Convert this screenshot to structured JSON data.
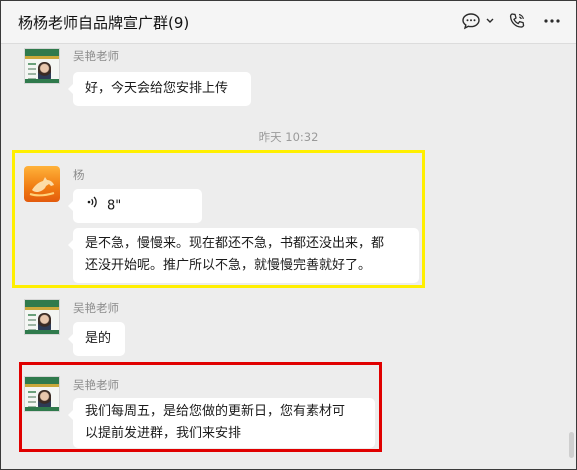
{
  "header": {
    "title": "杨杨老师自品牌宣广群",
    "member_count": "(9)",
    "icons": [
      "chat-bubble-icon",
      "chevron-down-icon",
      "voice-call-icon",
      "more-icon"
    ]
  },
  "messages": [
    {
      "sender": "吴艳老师",
      "text": "好，今天会给您安排上传",
      "avatar": "business-card-avatar"
    },
    {
      "timestamp": "昨天 10:32"
    },
    {
      "sender": "杨",
      "voice_duration": "8\"",
      "avatar": "horse-avatar",
      "text": "是不急，慢慢来。现在都还不急，书都还没出来，都还没开始呢。推广所以不急，就慢慢完善就好了。",
      "text_lines": [
        "是不急，慢慢来。现在都还不急，书都还没出来，都",
        "还没开始呢。推广所以不急，就慢慢完善就好了。"
      ]
    },
    {
      "sender": "吴艳老师",
      "text": "是的",
      "avatar": "business-card-avatar"
    },
    {
      "sender": "吴艳老师",
      "avatar": "business-card-avatar",
      "text": "我们每周五，是给您做的更新日，您有素材可以提前发进群，我们来安排",
      "text_lines": [
        "我们每周五，是给您做的更新日，您有素材可",
        "以提前发进群，我们来安排"
      ]
    }
  ],
  "highlights": {
    "yellow": "#ffef00",
    "red": "#e00000"
  },
  "colors": {
    "background": "#ededed",
    "bubble": "#ffffff",
    "header": "#f5f5f5"
  }
}
